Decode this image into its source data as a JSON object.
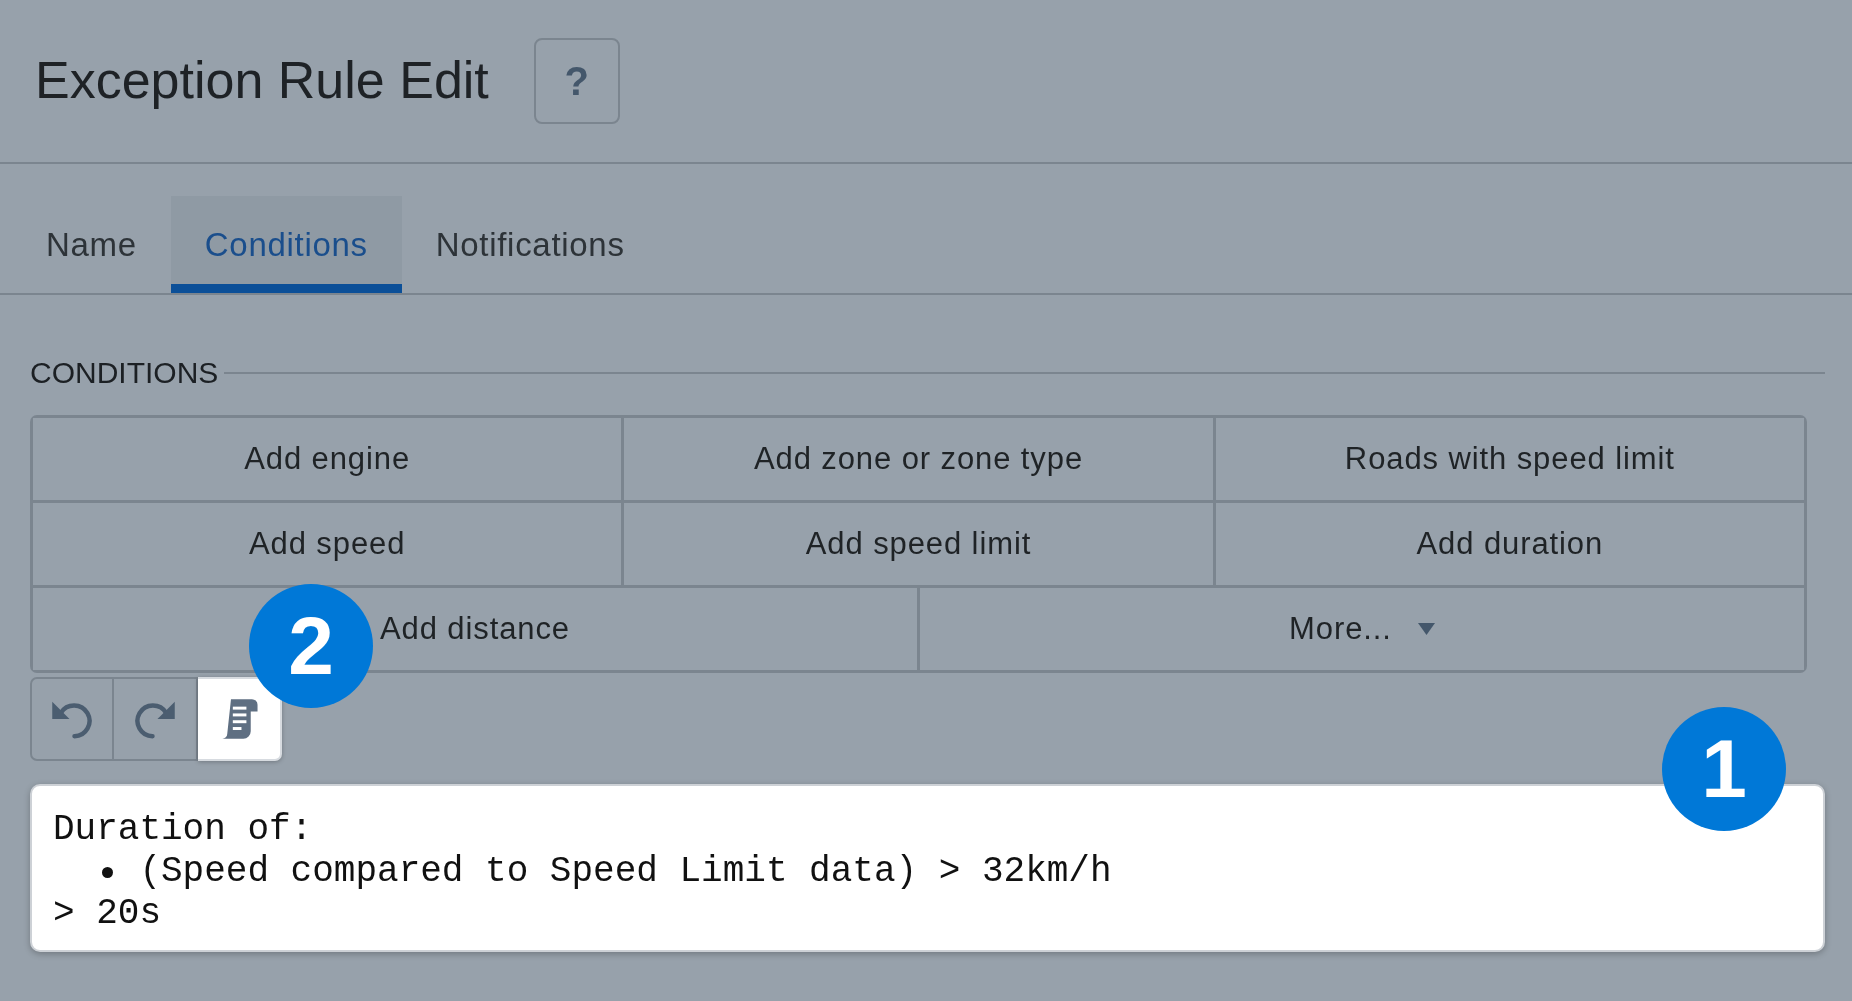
{
  "header": {
    "title": "Exception Rule Edit",
    "help_button": "?"
  },
  "tabs": [
    {
      "label": "Name",
      "selected": false
    },
    {
      "label": "Conditions",
      "selected": true
    },
    {
      "label": "Notifications",
      "selected": false
    }
  ],
  "conditions": {
    "heading": "CONDITIONS",
    "button_rows": [
      [
        {
          "label": "Add engine",
          "kind": "action"
        },
        {
          "label": "Add zone or zone type",
          "kind": "action"
        },
        {
          "label": "Roads with speed limit",
          "kind": "action"
        }
      ],
      [
        {
          "label": "Add speed",
          "kind": "action"
        },
        {
          "label": "Add speed limit",
          "kind": "action"
        },
        {
          "label": "Add duration",
          "kind": "action"
        }
      ],
      [
        {
          "label": "Add distance",
          "kind": "action"
        },
        {
          "label": "More...",
          "kind": "dropdown"
        }
      ]
    ],
    "toolbar": {
      "callout": "2",
      "buttons": [
        {
          "kind": "undo",
          "selected": false
        },
        {
          "kind": "redo",
          "selected": false
        },
        {
          "kind": "script",
          "selected": true
        }
      ]
    },
    "summary": {
      "callout": "1",
      "heading": "Duration of:",
      "items": [
        "(Speed compared to Speed Limit data) > 32km/h"
      ],
      "footer": "> 20s"
    }
  }
}
